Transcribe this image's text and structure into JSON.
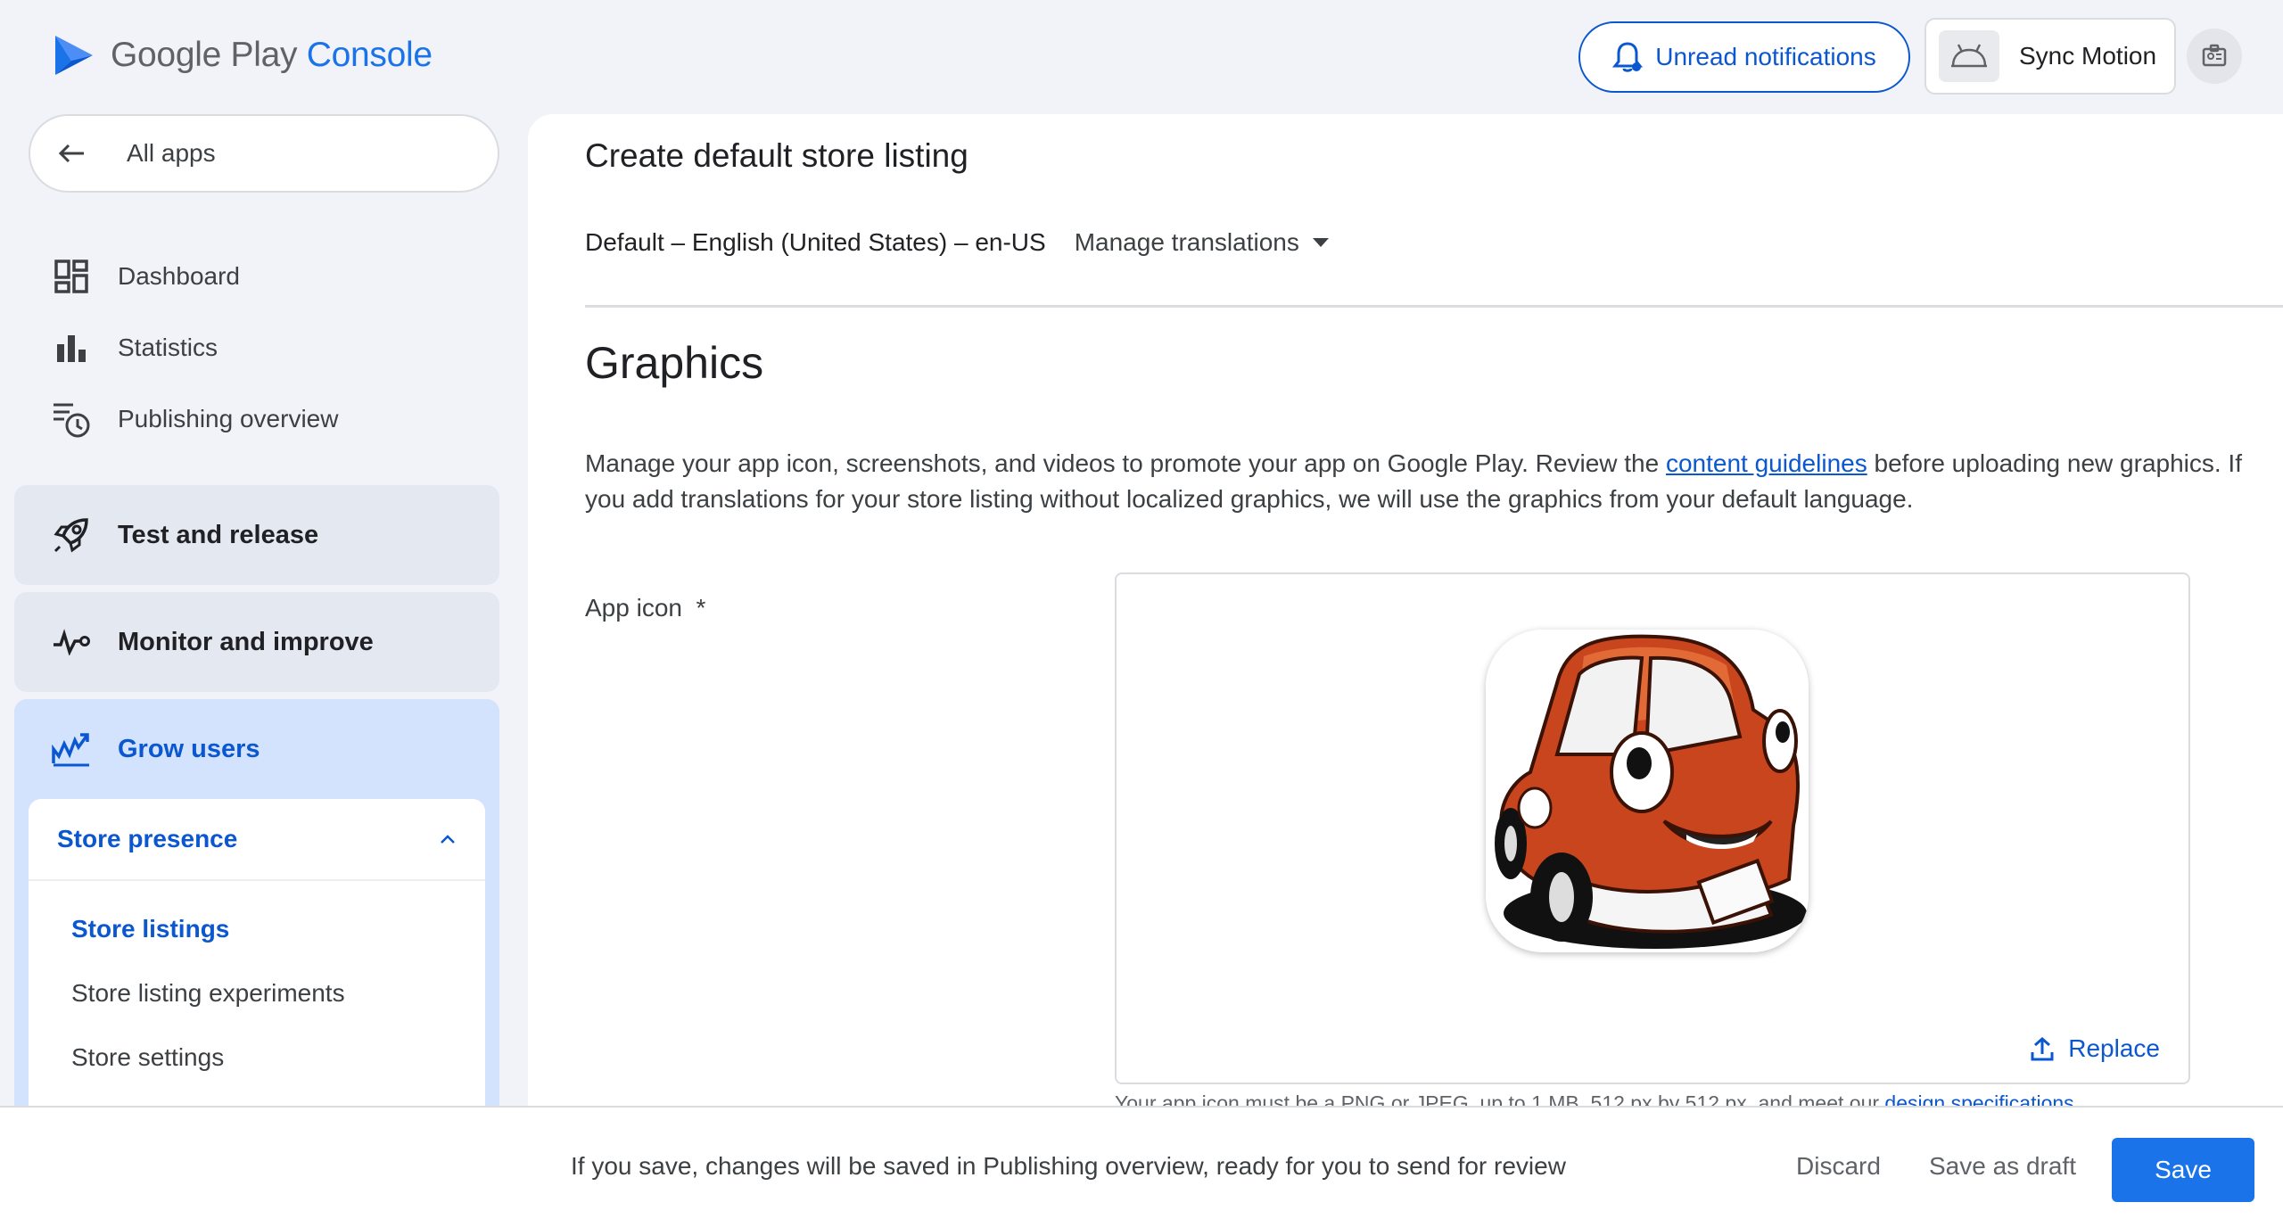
{
  "brand": {
    "name_primary": "Google Play",
    "name_accent": "Console",
    "color": "#1a73e8"
  },
  "header": {
    "notifications_label": "Unread notifications",
    "app_name": "Sync Motion"
  },
  "sidebar": {
    "all_apps": "All apps",
    "items": [
      {
        "label": "Dashboard",
        "icon": "dashboard-icon"
      },
      {
        "label": "Statistics",
        "icon": "bar-chart-icon"
      },
      {
        "label": "Publishing overview",
        "icon": "publishing-history-icon"
      }
    ],
    "groups": [
      {
        "label": "Test and release",
        "icon": "rocket-icon"
      },
      {
        "label": "Monitor and improve",
        "icon": "pulse-icon"
      },
      {
        "label": "Grow users",
        "icon": "growth-chart-icon"
      }
    ],
    "store_presence": {
      "label": "Store presence",
      "items": [
        "Store listings",
        "Store listing experiments",
        "Store settings"
      ],
      "active_index": 0
    }
  },
  "main": {
    "title": "Create default store listing",
    "language": "Default – English (United States) – en-US",
    "manage_translations": "Manage translations",
    "section_title": "Graphics",
    "description_before": "Manage your app icon, screenshots, and videos to promote your app on Google Play. Review the ",
    "description_link": "content guidelines",
    "description_after": " before uploading new graphics. If you add translations for your store listing without localized graphics, we will use the graphics from your default language.",
    "app_icon_label": "App icon",
    "required_mark": "*",
    "replace_label": "Replace",
    "hint_text": "Your app icon must be a PNG or JPEG, up to 1 MB, 512 px by 512 px, and meet our ",
    "hint_link": "design specifications"
  },
  "footer": {
    "message": "If you save, changes will be saved in Publishing overview, ready for you to send for review",
    "discard": "Discard",
    "save_draft": "Save as draft",
    "save": "Save"
  }
}
